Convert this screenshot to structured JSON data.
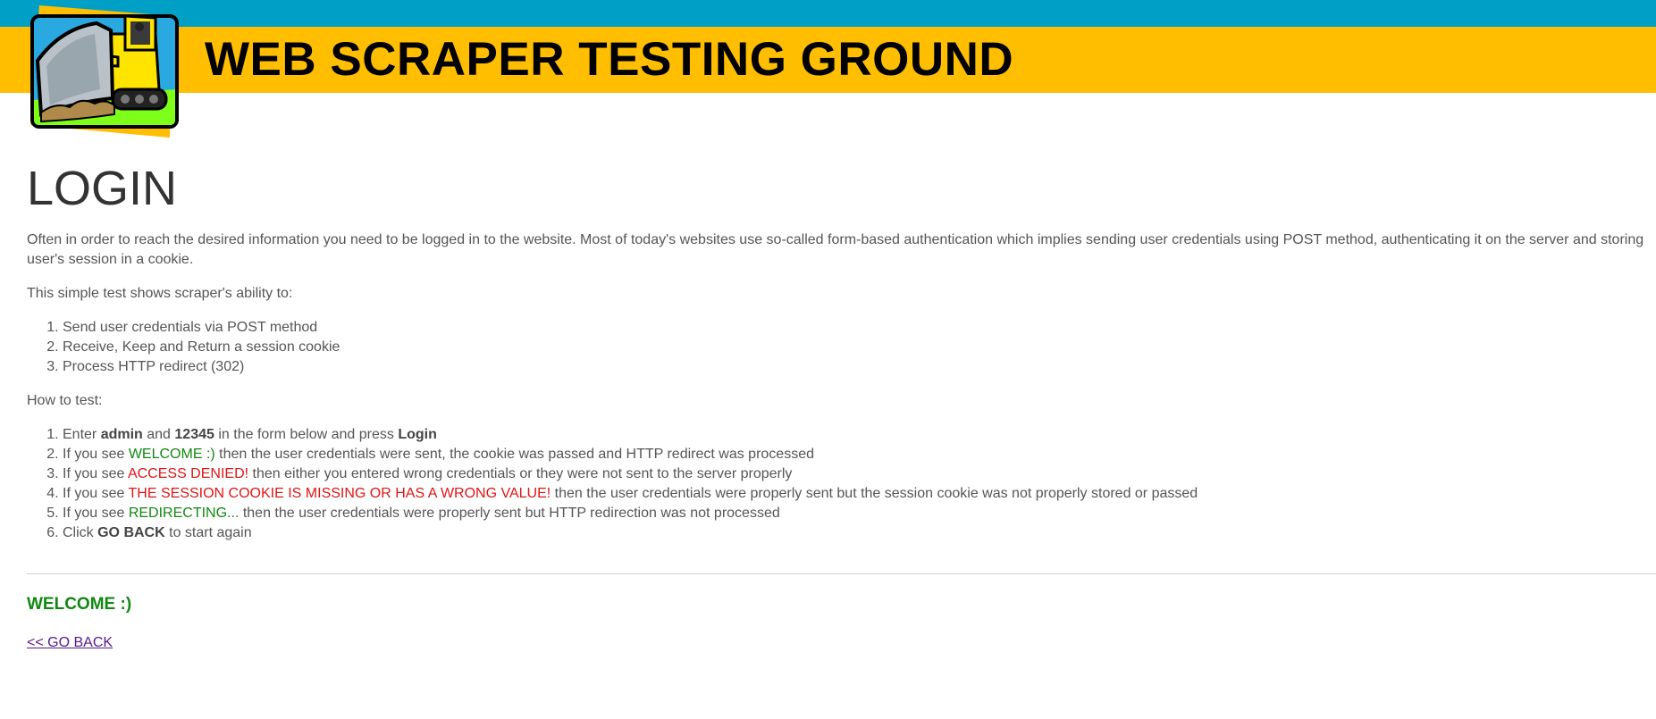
{
  "header": {
    "title": "WEB SCRAPER TESTING GROUND",
    "logo_icon": "bulldozer-logo-icon",
    "colors": {
      "top_band": "#00a0c6",
      "title_band": "#ffbe00"
    }
  },
  "page": {
    "heading": "LOGIN",
    "intro": "Often in order to reach the desired information you need to be logged in to the website. Most of today's websites use so-called form-based authentication which implies sending user credentials using POST method, authenticating it on the server and storing user's session in a cookie.",
    "ability_intro": "This simple test shows scraper's ability to:",
    "abilities": [
      "Send user credentials via POST method",
      "Receive, Keep and Return a session cookie",
      "Process HTTP redirect (302)"
    ],
    "how_intro": "How to test:",
    "steps": {
      "s1": {
        "a": "Enter ",
        "b": "admin",
        "c": " and ",
        "d": "12345",
        "e": " in the form below and press ",
        "f": "Login"
      },
      "s2": {
        "a": "If you see ",
        "b": "WELCOME :)",
        "c": " then the user credentials were sent, the cookie was passed and HTTP redirect was processed"
      },
      "s3": {
        "a": "If you see ",
        "b": "ACCESS DENIED!",
        "c": " then either you entered wrong credentials or they were not sent to the server properly"
      },
      "s4": {
        "a": "If you see ",
        "b": "THE SESSION COOKIE IS MISSING OR HAS A WRONG VALUE!",
        "c": " then the user credentials were properly sent but the session cookie was not properly stored or passed"
      },
      "s5": {
        "a": "If you see ",
        "b": "REDIRECTING...",
        "c": " then the user credentials were properly sent but HTTP redirection was not processed"
      },
      "s6": {
        "a": "Click ",
        "b": "GO BACK",
        "c": " to start again"
      }
    },
    "result": "WELCOME :)",
    "back_link": "<< GO BACK",
    "colors": {
      "success": "#118811",
      "error": "#e01515",
      "link_visited": "#551a8b"
    }
  }
}
